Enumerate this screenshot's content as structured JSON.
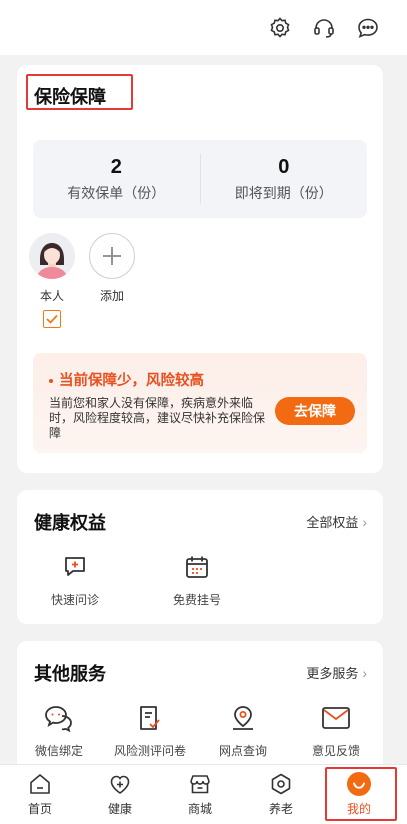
{
  "topbar": {
    "icons": [
      "settings-icon",
      "customer-service-icon",
      "message-icon"
    ]
  },
  "insurance": {
    "title": "保险保障",
    "summary": [
      {
        "value": "2",
        "label": "有效保单（份）"
      },
      {
        "value": "0",
        "label": "即将到期（份）"
      }
    ],
    "members": [
      {
        "label": "本人",
        "checked": true
      },
      {
        "label": "添加"
      }
    ],
    "warning": {
      "title": "当前保障少，风险较高",
      "desc": "当前您和家人没有保障，疾病意外来临时，风险程度较高，建议尽快补充保险保障",
      "button": "去保障"
    }
  },
  "health": {
    "title": "健康权益",
    "more": "全部权益",
    "items": [
      {
        "label": "快速问诊",
        "icon": "consult-icon"
      },
      {
        "label": "免费挂号",
        "icon": "calendar-icon"
      }
    ]
  },
  "other": {
    "title": "其他服务",
    "more": "更多服务",
    "items": [
      {
        "label": "微信绑定",
        "icon": "wechat-bind-icon"
      },
      {
        "label": "风险测评问卷",
        "icon": "questionnaire-icon"
      },
      {
        "label": "网点查询",
        "icon": "location-icon"
      },
      {
        "label": "意见反馈",
        "icon": "feedback-mail-icon"
      }
    ]
  },
  "tabbar": {
    "items": [
      {
        "label": "首页",
        "icon": "home-icon"
      },
      {
        "label": "健康",
        "icon": "health-icon"
      },
      {
        "label": "商城",
        "icon": "store-icon"
      },
      {
        "label": "养老",
        "icon": "pension-icon"
      },
      {
        "label": "我的",
        "icon": "profile-smile-icon",
        "active": true
      }
    ]
  },
  "colors": {
    "accent": "#f26a12",
    "warning_text": "#e8501f",
    "highlight_box": "#e53935"
  }
}
